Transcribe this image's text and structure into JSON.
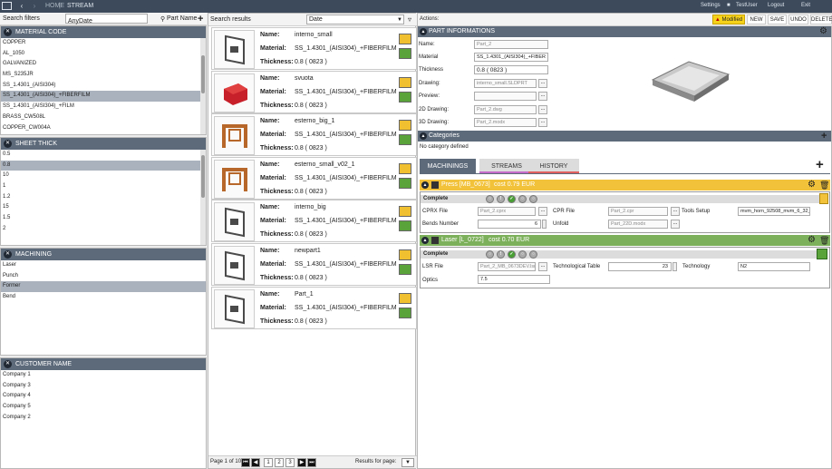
{
  "titlebar": {
    "home": "HOME",
    "stream": "STREAM",
    "settings": "Settings",
    "user": "TestUser",
    "logout": "Logout",
    "exit": "Exit"
  },
  "filters": {
    "search_label": "Search filters",
    "date_select": "AnyDate",
    "part_name": "Part Name"
  },
  "material": {
    "title": "MATERIAL CODE",
    "items": [
      "COPPER",
      "AL_1050",
      "GALVANIZED",
      "MS_S235JR",
      "SS_1.4301_(AISI304)",
      "SS_1.4301_(AISI304)_+FIBERFILM",
      "SS_1.4301_(AISI304)_+FILM",
      "BRASS_CW508L",
      "COPPER_CW004A"
    ],
    "selected_index": 5,
    "scroll": {
      "position": 0.3,
      "visible": 0.4
    }
  },
  "thick": {
    "title": "SHEET THICK",
    "items": [
      "0.5",
      "0.8",
      "10",
      "1",
      "1.2",
      "15",
      "1.5",
      "2"
    ],
    "selected_index": 1,
    "scroll": {
      "position": 0.1,
      "visible": 0.45
    }
  },
  "machining": {
    "title": "MACHINING",
    "items": [
      "Laser",
      "Punch",
      "Former",
      "Bend"
    ],
    "selected_index": 2
  },
  "customer": {
    "title": "CUSTOMER NAME",
    "items": [
      "Company 1",
      "Company 3",
      "Company 4",
      "Company 5",
      "Company 2"
    ]
  },
  "results": {
    "search_label": "Search results",
    "sort": "Date",
    "labels": {
      "name": "Name:",
      "material": "Material:",
      "thickness": "Thickness:"
    },
    "items": [
      {
        "name": "interno_small",
        "material": "SS_1.4301_(AISI304)_+FIBERFILM",
        "thickness": "0.8  ( 0823 )"
      },
      {
        "name": "svuota",
        "material": "SS_1.4301_(AISI304)_+FIBERFILM",
        "thickness": "0.8  ( 0823 )"
      },
      {
        "name": "esterno_big_1",
        "material": "SS_1.4301_(AISI304)_+FIBERFILM",
        "thickness": "0.8  ( 0823 )"
      },
      {
        "name": "esterno_small_v02_1",
        "material": "SS_1.4301_(AISI304)_+FIBERFILM",
        "thickness": "0.8  ( 0823 )"
      },
      {
        "name": "interno_big",
        "material": "SS_1.4301_(AISI304)_+FIBERFILM",
        "thickness": "0.8  ( 0823 )"
      },
      {
        "name": "newpart1",
        "material": "SS_1.4301_(AISI304)_+FIBERFILM",
        "thickness": "0.8  ( 0823 )"
      },
      {
        "name": "Part_1",
        "material": "SS_1.4301_(AISI304)_+FIBERFILM",
        "thickness": "0.8  ( 0823 )"
      }
    ],
    "pager": {
      "page_label": "Page 1 of 10",
      "pages": [
        "1",
        "2",
        "3"
      ],
      "results_label": "Results for page:"
    }
  },
  "actions": {
    "label": "Actions:",
    "modified": "Modified",
    "new": "NEW",
    "save": "SAVE",
    "undo": "UNDO",
    "delete": "DELETE"
  },
  "part_info": {
    "title": "PART INFORMATIONS",
    "name_label": "Name:",
    "name": "Part_2",
    "material_label": "Material",
    "material": "SS_1.4301_(AISI304)_+FIBER",
    "thickness_label": "Thickness",
    "thickness": "0.8  ( 0823 )",
    "drawing_label": "Drawing:",
    "drawing": "interno_small.SLDPRT",
    "preview_label": "Preview:",
    "drawing2d_label": "2D Drawing:",
    "drawing2d": "Part_2.dwg",
    "drawing3d_label": "3D Drawing:",
    "drawing3d": "Part_2.modx"
  },
  "categories": {
    "title": "Categories",
    "empty": "No category defined"
  },
  "tabs": [
    "MACHININGS",
    "STREAMS",
    "HISTORY"
  ],
  "press": {
    "title": "Press [MB_0673]",
    "cost": "cost 0.79 EUR",
    "status": "Complete",
    "cprx_label": "CPRX File",
    "cprx": "Part_2.cprx",
    "cpr_label": "CPR File",
    "cpr": "Part_2.cpr",
    "tools_label": "Tools Setup",
    "tools": "mvm_horn_92508_mvm_6_32_",
    "bends_label": "Bends Number",
    "bends": "6",
    "unfold_label": "Unfold",
    "unfold": "Part_22D.modx"
  },
  "laser": {
    "title": "Laser [L_0722]",
    "cost": "cost 0.70 EUR",
    "status": "Complete",
    "lsr_label": "LSR File",
    "lsr": "Part_2_MB_0673DEV.lsr",
    "tech_table_label": "Technological Table",
    "tech_table": "23",
    "tech_label": "Technology",
    "tech": "N2",
    "optics_label": "Optics",
    "optics": "7.5"
  },
  "colors": {
    "header": "#5d6a7a",
    "press": "#f2c23a",
    "laser": "#7db05a",
    "tab_active": "#5d6a7a",
    "streams_underline": "#c46ac9",
    "history_underline": "#e06060"
  }
}
